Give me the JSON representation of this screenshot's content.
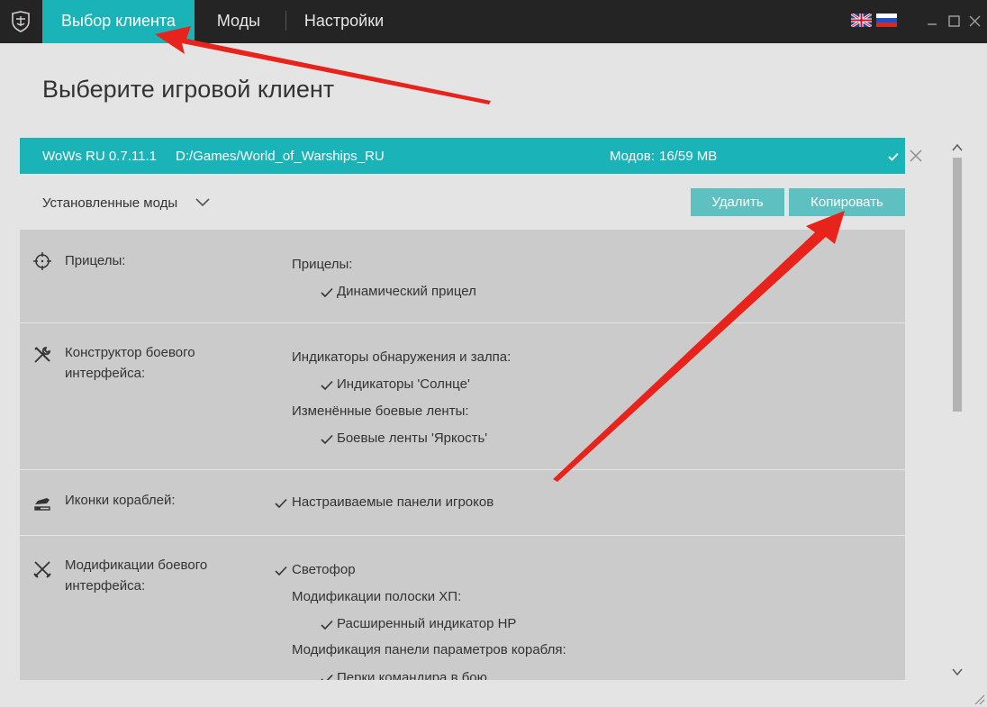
{
  "titlebar": {
    "tabs": [
      {
        "label": "Выбор клиента",
        "active": true
      },
      {
        "label": "Моды",
        "active": false
      },
      {
        "label": "Настройки",
        "active": false
      }
    ],
    "languages": [
      "en",
      "ru"
    ]
  },
  "page": {
    "title": "Выберите игровой клиент"
  },
  "client": {
    "name": "WoWs RU 0.7.11.1",
    "path": "D:/Games/World_of_Warships_RU",
    "mods_label": "Модов:",
    "mods_value": "16/59 MB"
  },
  "installed": {
    "label": "Установленные моды",
    "delete_label": "Удалить",
    "copy_label": "Копировать"
  },
  "sections": [
    {
      "title": "Прицелы:",
      "icon": "crosshair-icon",
      "items": [
        {
          "text": "Прицелы:",
          "checked": false,
          "level": 1
        },
        {
          "text": "Динамический прицел",
          "checked": true,
          "level": 2
        }
      ]
    },
    {
      "title": "Конструктор боевого интерфейса:",
      "icon": "tools-icon",
      "items": [
        {
          "text": "Индикаторы обнаружения и залпа:",
          "checked": false,
          "level": 1
        },
        {
          "text": "Индикаторы 'Солнце'",
          "checked": true,
          "level": 2
        },
        {
          "text": "Изменённые боевые ленты:",
          "checked": false,
          "level": 1
        },
        {
          "text": "Боевые ленты 'Яркость'",
          "checked": true,
          "level": 2
        }
      ]
    },
    {
      "title": "Иконки кораблей:",
      "icon": "ship-icon",
      "items": [
        {
          "text": "Настраиваемые панели игроков",
          "checked": true,
          "level": 1
        }
      ]
    },
    {
      "title": "Модификации боевого интерфейса:",
      "icon": "swords-icon",
      "items": [
        {
          "text": "Светофор",
          "checked": true,
          "level": 1
        },
        {
          "text": "Модификации полоски ХП:",
          "checked": false,
          "level": 1
        },
        {
          "text": "Расширенный индикатор HP",
          "checked": true,
          "level": 2
        },
        {
          "text": "Модификация панели параметров корабля:",
          "checked": false,
          "level": 1
        },
        {
          "text": "Перки командира в бою",
          "checked": true,
          "level": 2
        }
      ]
    }
  ],
  "colors": {
    "accent": "#19b3b8",
    "button": "#5fc0c2",
    "titlebar": "#242424",
    "annotation_arrow": "#e8231b"
  }
}
